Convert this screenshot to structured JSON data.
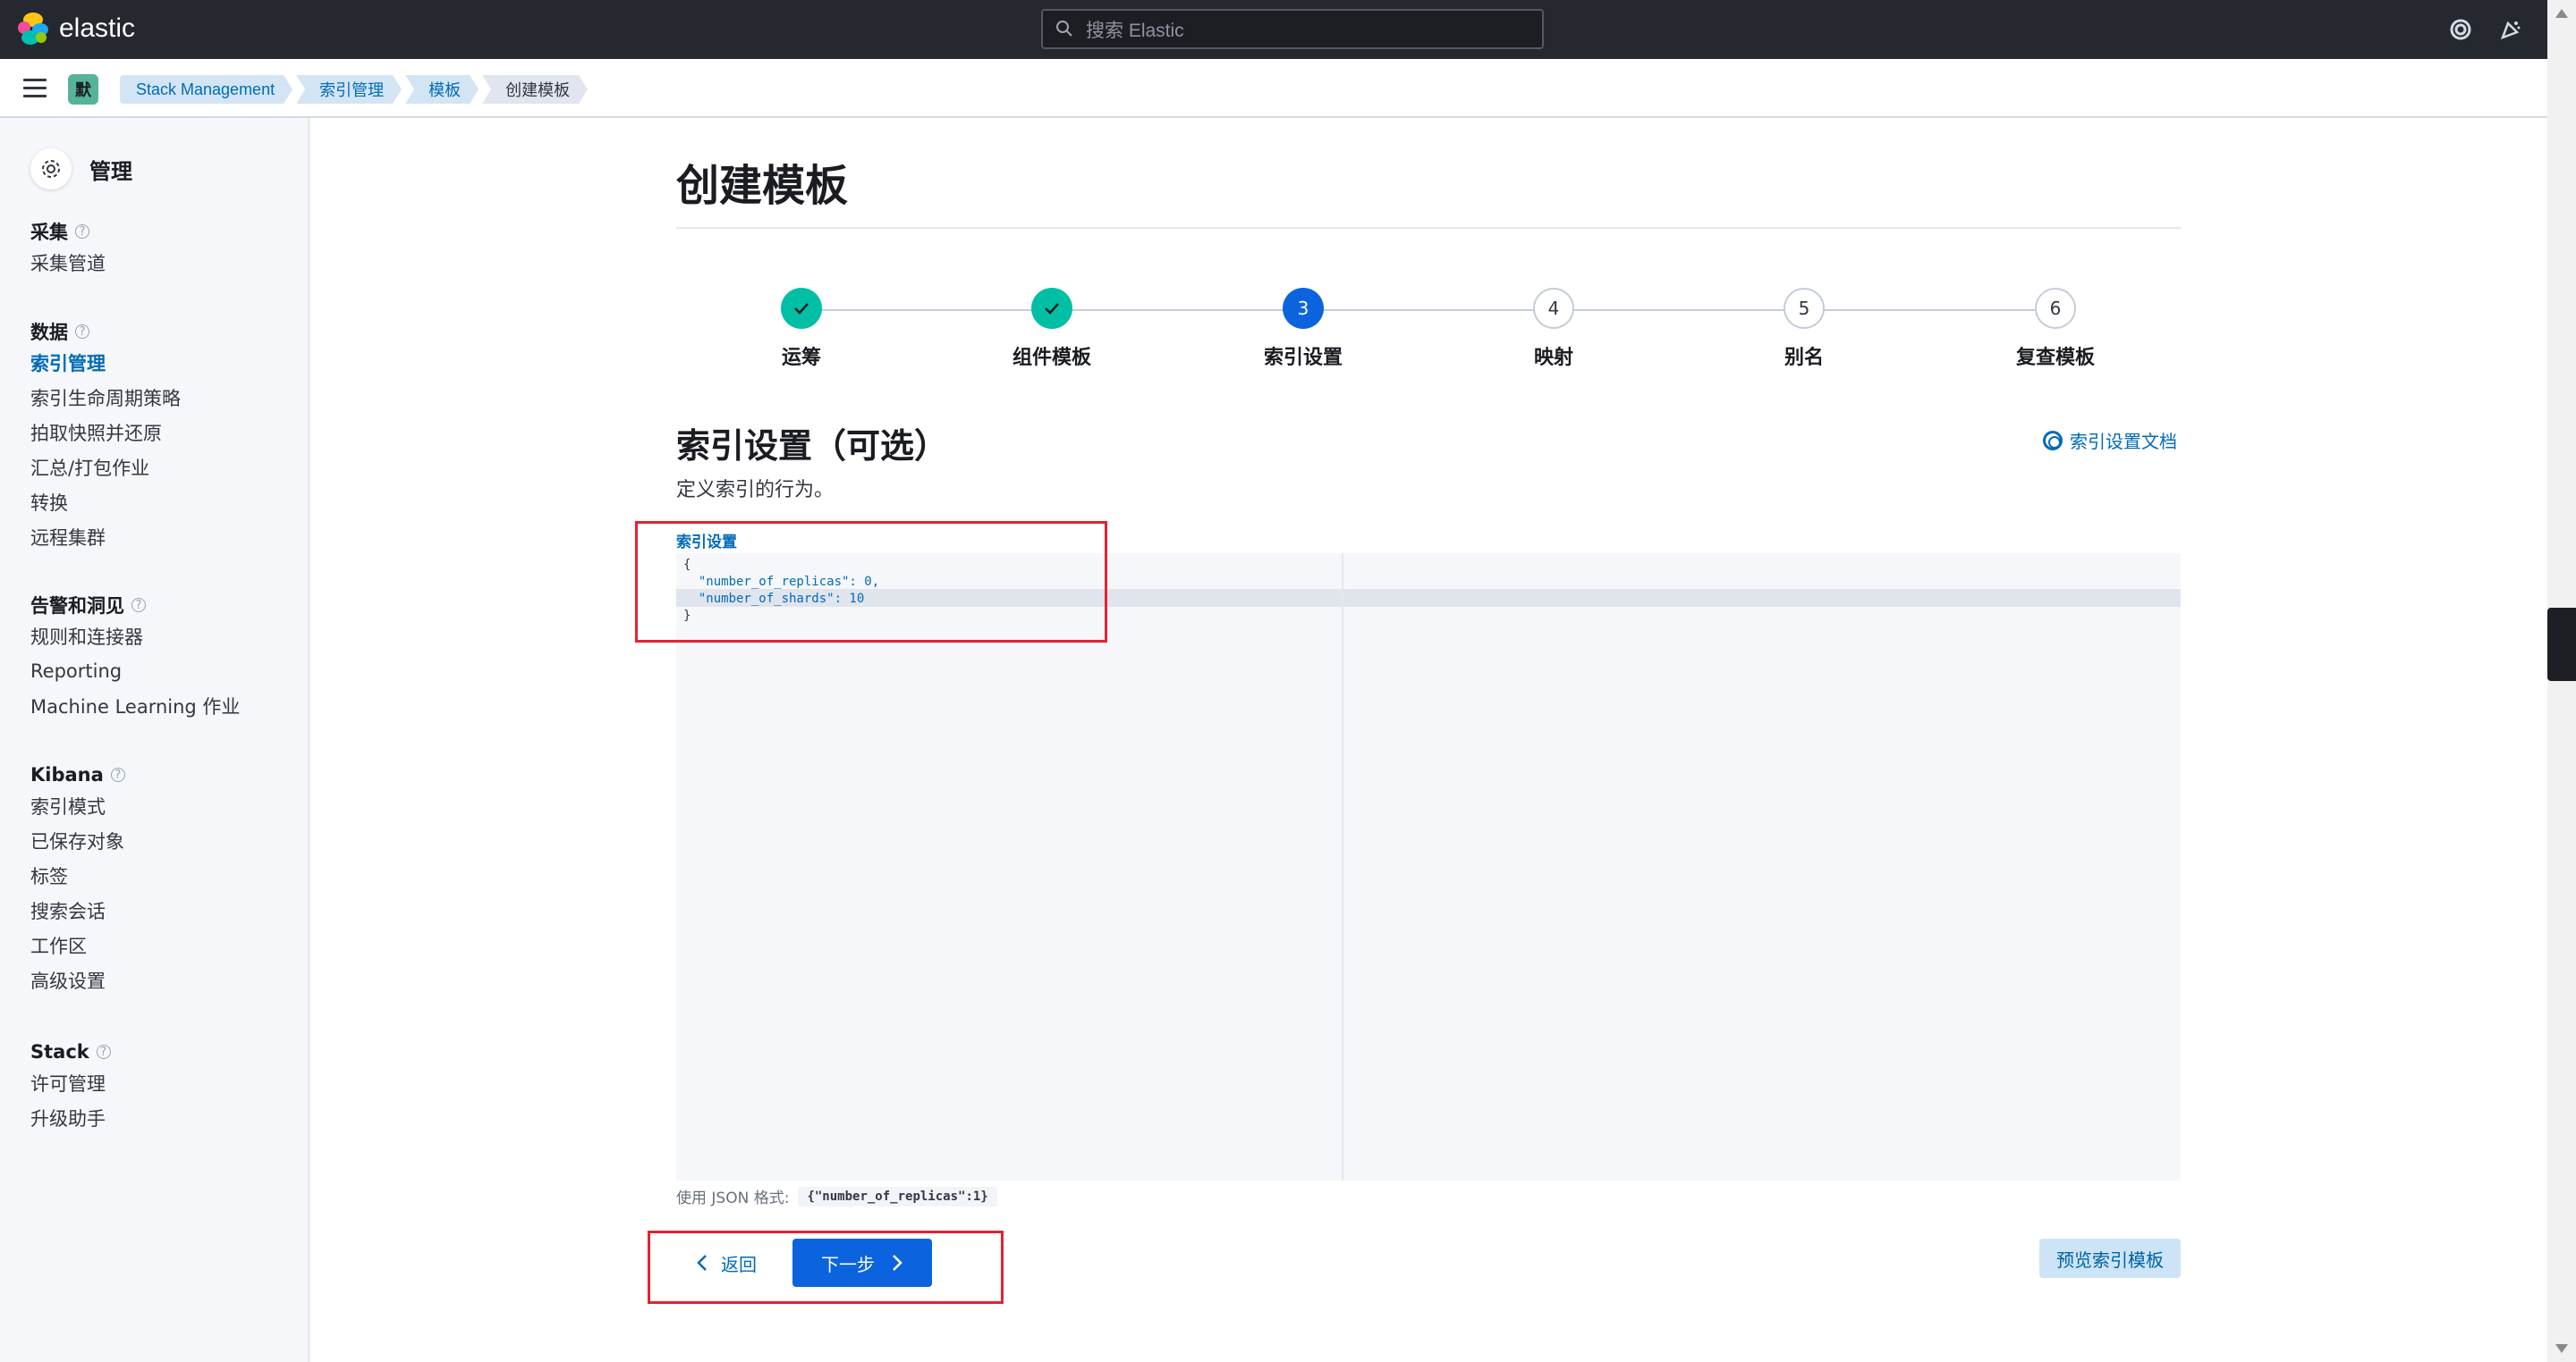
{
  "header": {
    "brand": "elastic",
    "search_placeholder": "搜索 Elastic"
  },
  "breadcrumbs": {
    "space_initial": "默",
    "items": [
      "Stack Management",
      "索引管理",
      "模板",
      "创建模板"
    ]
  },
  "sidebar": {
    "title": "管理",
    "groups": [
      {
        "title": "采集",
        "items": [
          "采集管道"
        ]
      },
      {
        "title": "数据",
        "items": [
          "索引管理",
          "索引生命周期策略",
          "拍取快照并还原",
          "汇总/打包作业",
          "转换",
          "远程集群"
        ]
      },
      {
        "title": "告警和洞见",
        "items": [
          "规则和连接器",
          "Reporting",
          "Machine Learning 作业"
        ]
      },
      {
        "title": "Kibana",
        "items": [
          "索引模式",
          "已保存对象",
          "标签",
          "搜索会话",
          "工作区",
          "高级设置"
        ]
      },
      {
        "title": "Stack",
        "items": [
          "许可管理",
          "升级助手"
        ]
      }
    ],
    "active_item": "索引管理"
  },
  "main": {
    "page_title": "创建模板",
    "steps": [
      {
        "label": "运筹",
        "number": "1",
        "status": "complete"
      },
      {
        "label": "组件模板",
        "number": "2",
        "status": "complete"
      },
      {
        "label": "索引设置",
        "number": "3",
        "status": "current"
      },
      {
        "label": "映射",
        "number": "4",
        "status": "incomplete"
      },
      {
        "label": "别名",
        "number": "5",
        "status": "incomplete"
      },
      {
        "label": "复查模板",
        "number": "6",
        "status": "incomplete"
      }
    ],
    "section_title": "索引设置（可选）",
    "section_desc": "定义索引的行为。",
    "doc_link": "索引设置文档",
    "editor_label": "索引设置",
    "editor_lines": [
      "{",
      "  \"number_of_replicas\": 0,",
      "  \"number_of_shards\": 10",
      "}"
    ],
    "help_text": "使用 JSON 格式:",
    "help_example": "{\"number_of_replicas\":1}",
    "back_label": "返回",
    "next_label": "下一步",
    "preview_label": "预览索引模板"
  },
  "colors": {
    "accent": "#0b64dd",
    "complete": "#00bfa5",
    "annotation": "#e32232"
  }
}
